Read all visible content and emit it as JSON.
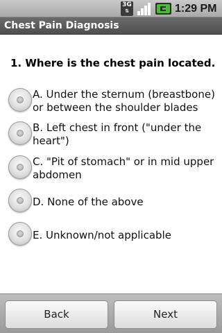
{
  "status_bar": {
    "network": "3G",
    "time": "1:29 PM"
  },
  "title_bar": {
    "title": "Chest Pain Diagnosis"
  },
  "question": {
    "text": "1.   Where is the chest pain located."
  },
  "options": [
    {
      "label": "A.  Under the sternum (breastbone) or between the shoulder blades"
    },
    {
      "label": "B.  Left chest in front (\"under the heart\")"
    },
    {
      "label": "C.  \"Pit of stomach\" or in mid upper abdomen"
    },
    {
      "label": "D.  None of the above"
    },
    {
      "label": "E.  Unknown/not applicable"
    }
  ],
  "buttons": {
    "back": "Back",
    "next": "Next"
  },
  "colors": {
    "status_bar": "#b0b0b0",
    "title_bar": "#5a5a5a",
    "battery_green": "#4fb83a"
  }
}
